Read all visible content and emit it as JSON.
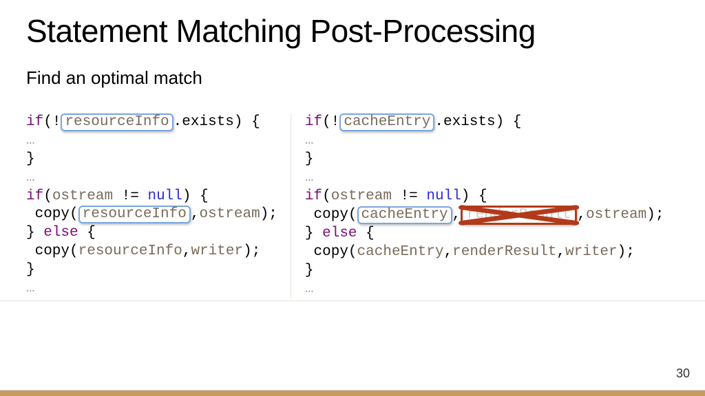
{
  "title": "Statement Matching Post-Processing",
  "subtitle": "Find an optimal match",
  "pagenum": "30",
  "kw": {
    "if": "if",
    "else": "else",
    "null": "null"
  },
  "punct": {
    "bang_open": "(!",
    "dot": ".",
    "exists_close": "exists) {",
    "open": "(",
    "ne": " != ",
    "close_brace_open": ") {",
    "close_brace": "}",
    "semi": ");",
    "brace_else": "} ",
    " {": " {",
    "comma": ",",
    "space": " "
  },
  "left": {
    "var_boxed": "resourceInfo",
    "ostream": "ostream",
    "copy": " copy",
    "writer": "writer",
    "resourceInfo": "resourceInfo",
    "ellipsis": "…"
  },
  "right": {
    "var_boxed": "cacheEntry",
    "ostream": "ostream",
    "copy": " copy",
    "writer": "writer",
    "cacheEntry": "cacheEntry",
    "renderResult": "renderResult",
    "crossed": "renderResult",
    "ellipsis": "…"
  }
}
